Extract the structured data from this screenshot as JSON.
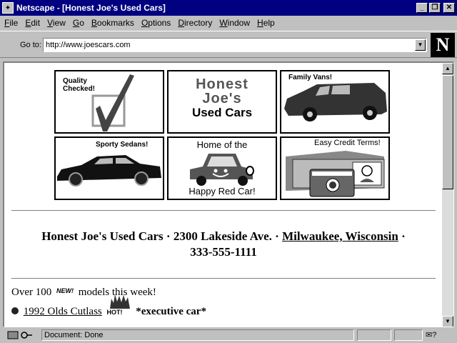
{
  "window": {
    "title": "Netscape - [Honest Joe's Used Cars]",
    "minimize_glyph": "_",
    "maximize_glyph": "❐",
    "close_glyph": "✕"
  },
  "menu": [
    {
      "key": "F",
      "rest": "ile"
    },
    {
      "key": "E",
      "rest": "dit"
    },
    {
      "key": "V",
      "rest": "iew"
    },
    {
      "key": "G",
      "rest": "o"
    },
    {
      "key": "B",
      "rest": "ookmarks"
    },
    {
      "key": "O",
      "rest": "ptions"
    },
    {
      "key": "D",
      "rest": "irectory"
    },
    {
      "key": "W",
      "rest": "indow"
    },
    {
      "key": "H",
      "rest": "elp"
    }
  ],
  "location": {
    "label": "Go to:",
    "url": "http://www.joescars.com"
  },
  "logo_letter": "N",
  "tiles": {
    "quality_line1": "Quality",
    "quality_line2": "Checked!",
    "brand_line1": "Honest",
    "brand_line2": "Joe's",
    "brand_line3": "Used Cars",
    "vans": "Family Vans!",
    "sedans": "Sporty Sedans!",
    "home_top": "Home of the",
    "home_bottom": "Happy Red Car!",
    "credit": "Easy Credit Terms!"
  },
  "address": {
    "part1": "Honest Joe's Used Cars · 2300 Lakeside Ave. · ",
    "city_link": "Milwaukee, Wisconsin",
    "part2": " ·",
    "phone": "333-555-1111"
  },
  "promo": {
    "prefix": "Over 100",
    "new_badge": "NEW!",
    "suffix": "models this week!"
  },
  "listing": {
    "car_link": "1992 Olds Cutlass",
    "hot_badge": "HOT!",
    "tag": "*executive car*"
  },
  "status": {
    "text": "Document: Done"
  }
}
